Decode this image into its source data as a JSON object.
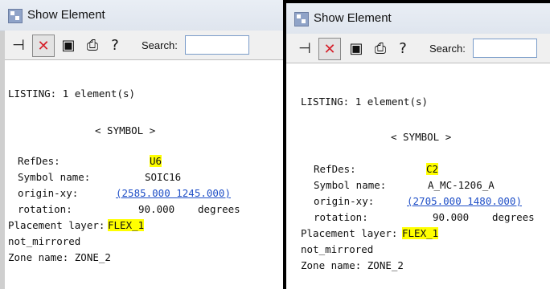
{
  "windows": [
    {
      "title": "Show Element",
      "search_label": "Search:",
      "listing": "LISTING: 1 element(s)",
      "section": "< SYMBOL >",
      "refdes_label": "RefDes:",
      "refdes_value": "U6",
      "symbol_name_label": "Symbol name:",
      "symbol_name_value": "SOIC16",
      "origin_label": "origin-xy:",
      "origin_value": "(2585.000 1245.000)",
      "rotation_label": "rotation:",
      "rotation_value": "90.000",
      "rotation_unit": "degrees",
      "placement_label": "Placement layer:",
      "placement_value": "FLEX_1",
      "mirror": "not_mirrored",
      "zone": "Zone name: ZONE_2"
    },
    {
      "title": "Show Element",
      "search_label": "Search:",
      "listing": "LISTING: 1 element(s)",
      "section": "< SYMBOL >",
      "refdes_label": "RefDes:",
      "refdes_value": "C2",
      "symbol_name_label": "Symbol name:",
      "symbol_name_value": "A_MC-1206_A",
      "origin_label": "origin-xy:",
      "origin_value": "(2705.000 1480.000)",
      "rotation_label": "rotation:",
      "rotation_value": "90.000",
      "rotation_unit": "degrees",
      "placement_label": "Placement layer:",
      "placement_value": "FLEX_1",
      "mirror": "not_mirrored",
      "zone": "Zone name: ZONE_2"
    }
  ]
}
